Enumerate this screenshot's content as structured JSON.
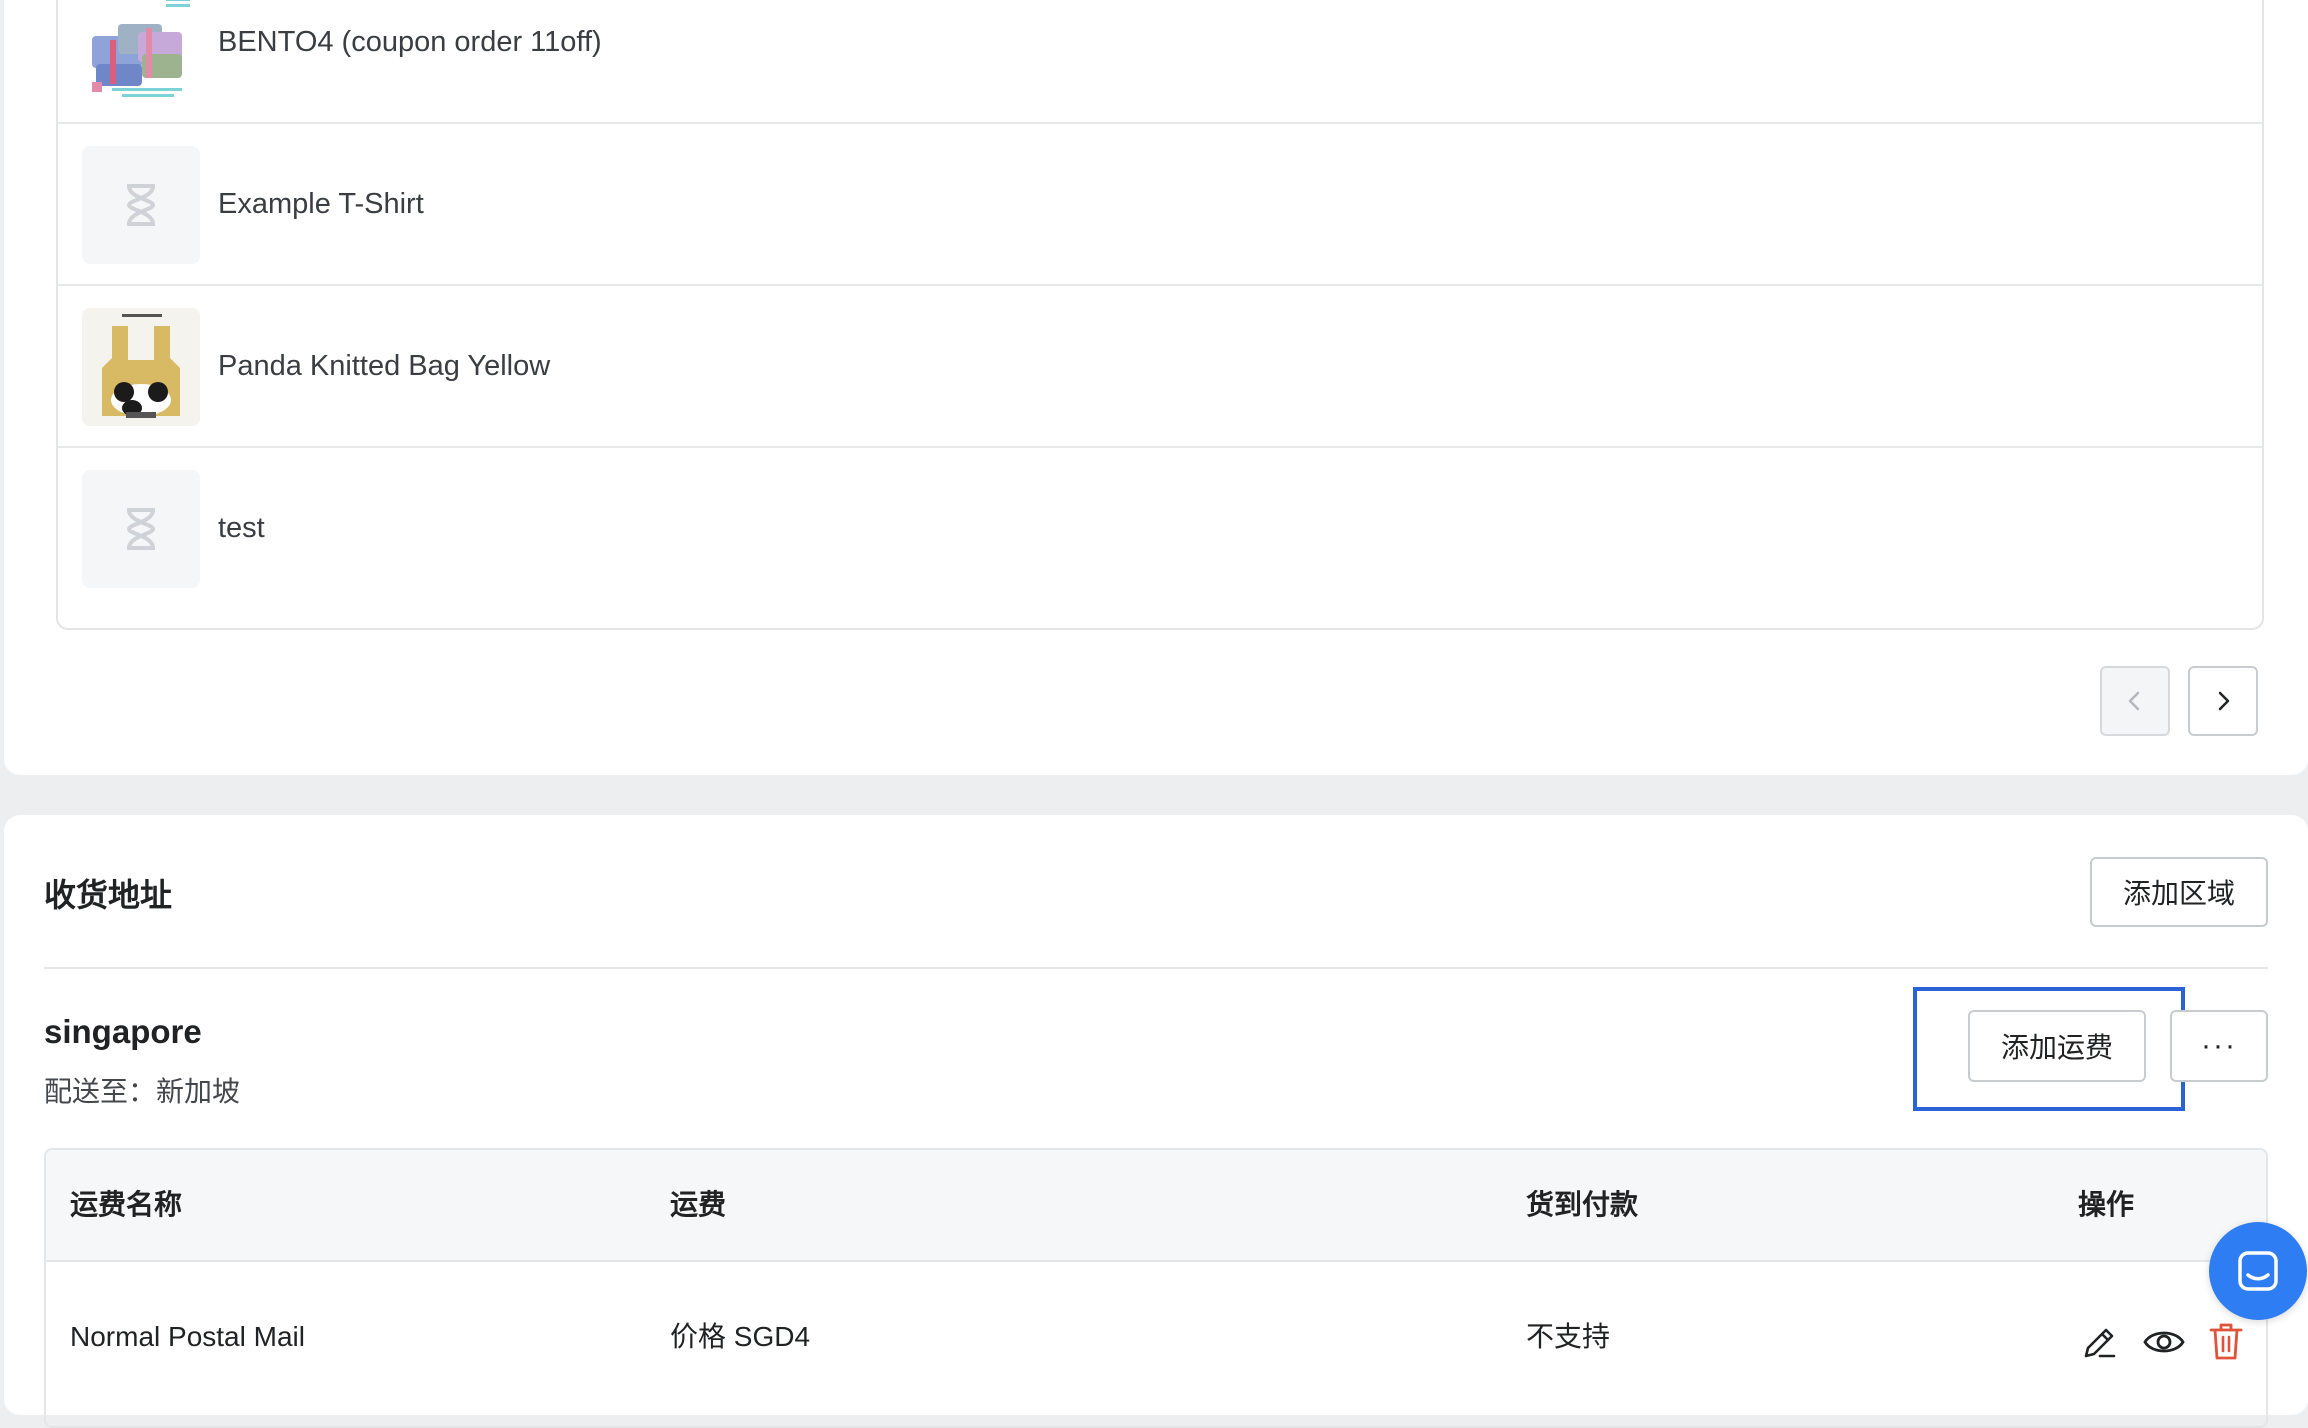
{
  "products": [
    {
      "name": "BENTO4 (coupon order 11off)",
      "thumb": "bento-box-photo"
    },
    {
      "name": "Example T-Shirt",
      "thumb": "hourglass-placeholder-icon"
    },
    {
      "name": "Panda Knitted Bag Yellow",
      "thumb": "panda-bag-photo"
    },
    {
      "name": "test",
      "thumb": "hourglass-placeholder-icon"
    }
  ],
  "pager": {
    "prev_icon": "chevron-left-icon",
    "next_icon": "chevron-right-icon",
    "prev_disabled": true
  },
  "shipping": {
    "title": "收货地址",
    "add_zone_label": "添加区域",
    "zone": {
      "name": "singapore",
      "dest_label": "配送至：",
      "dest_value": "新加坡",
      "add_rate_label": "添加运费",
      "more_label": "···"
    },
    "table": {
      "headers": [
        "运费名称",
        "运费",
        "货到付款",
        "操作"
      ],
      "rows": [
        {
          "name": "Normal Postal Mail",
          "price": "价格 SGD4",
          "cod": "不支持"
        }
      ],
      "actions": [
        "edit-icon",
        "view-icon",
        "delete-icon"
      ]
    }
  },
  "colors": {
    "highlight": "#2a62d8",
    "delete": "#e0533a",
    "chat": "#2f7df2"
  }
}
